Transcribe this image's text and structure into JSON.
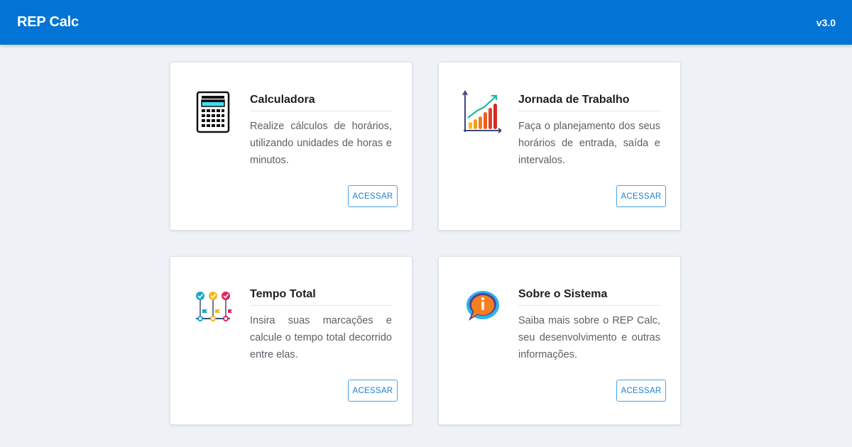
{
  "header": {
    "brand": "REP Calc",
    "version": "v3.0"
  },
  "cards": [
    {
      "title": "Calculadora",
      "description": "Realize cálculos de horários, utilizando unidades de horas e minutos.",
      "button": "ACESSAR",
      "icon": "calculator-icon"
    },
    {
      "title": "Jornada de Trabalho",
      "description": "Faça o planejamento dos seus horários de entrada, saída e intervalos.",
      "button": "ACESSAR",
      "icon": "bar-chart-icon"
    },
    {
      "title": "Tempo Total",
      "description": "Insira suas marcações e calcule o tempo total decorrido entre elas.",
      "button": "ACESSAR",
      "icon": "timeline-icon"
    },
    {
      "title": "Sobre o Sistema",
      "description": "Saiba mais sobre o REP Calc, seu desenvolvimento e outras informações.",
      "button": "ACESSAR",
      "icon": "info-bubble-icon"
    }
  ],
  "colors": {
    "header": "#0274d6",
    "background": "#eef1f6",
    "button_text": "#1c7fd1"
  }
}
